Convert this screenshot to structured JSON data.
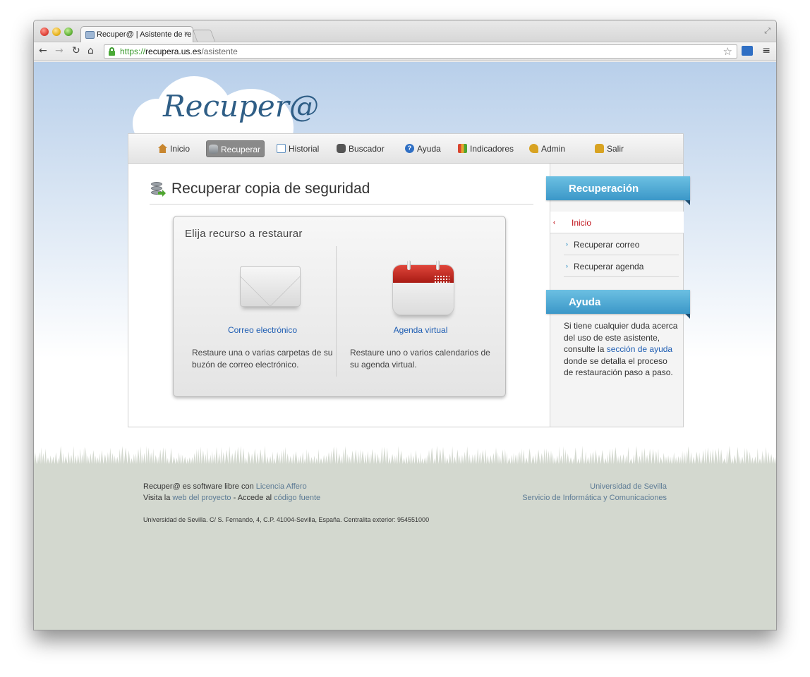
{
  "browser": {
    "tab_title": "Recuper@ | Asistente de re",
    "url_protocol": "https://",
    "url_host": "recupera.us.es",
    "url_path": "/asistente"
  },
  "site": {
    "logo": "Recuper@"
  },
  "menu": {
    "items": [
      {
        "label": "Inicio",
        "icon": "home-icon",
        "color": "#c8862f"
      },
      {
        "label": "Recuperar",
        "icon": "database-restore-icon",
        "color": "#4ea52f",
        "active": true
      },
      {
        "label": "Historial",
        "icon": "history-chart-icon",
        "color": "#5f8fbf"
      },
      {
        "label": "Buscador",
        "icon": "binoculars-icon",
        "color": "#555555"
      },
      {
        "label": "Ayuda",
        "icon": "help-icon",
        "color": "#2f6fc4"
      },
      {
        "label": "Indicadores",
        "icon": "bar-chart-icon",
        "color": "#d9452f"
      },
      {
        "label": "Admin",
        "icon": "key-icon",
        "color": "#d8a322"
      },
      {
        "label": "Salir",
        "icon": "exit-lock-icon",
        "color": "#d8a322"
      }
    ]
  },
  "main": {
    "title": "Recuperar copia de seguridad",
    "chooser_title": "Elija recurso a restaurar",
    "options": [
      {
        "label": "Correo electrónico",
        "desc": "Restaure una o varias carpetas de su buzón de correo electrónico.",
        "icon": "envelope-icon"
      },
      {
        "label": "Agenda virtual",
        "desc": "Restaure uno o varios calendarios de su agenda virtual.",
        "icon": "calendar-icon"
      }
    ]
  },
  "sidebar": {
    "recovery_header": "Recuperación",
    "recovery_items": [
      {
        "label": "Inicio",
        "current": true
      },
      {
        "label": "Recuperar correo",
        "current": false
      },
      {
        "label": "Recuperar agenda",
        "current": false
      }
    ],
    "help_header": "Ayuda",
    "help_text_before": "Si tiene cualquier duda acerca del uso de este asistente, consulte la ",
    "help_link": "sección de ayuda",
    "help_text_after": " donde se detalla el proceso de restauración paso a paso."
  },
  "footer": {
    "line1_text": "Recuper@ es software libre con ",
    "line1_link": "Licencia Affero",
    "line2_text_a": "Visita la ",
    "line2_link_a": "web del proyecto",
    "line2_text_b": " - Accede al ",
    "line2_link_b": "código fuente",
    "university": "Universidad de Sevilla",
    "service": "Servicio de Informática y Comunicaciones",
    "address": "Universidad de Sevilla. C/ S. Fernando, 4, C.P. 41004-Sevilla, España. Centralita exterior: 954551000"
  },
  "colors": {
    "accent_blue": "#3b97c8",
    "link_blue": "#1f5eb3",
    "current_red": "#c0141c",
    "footer_bg": "#d3d8cf"
  }
}
